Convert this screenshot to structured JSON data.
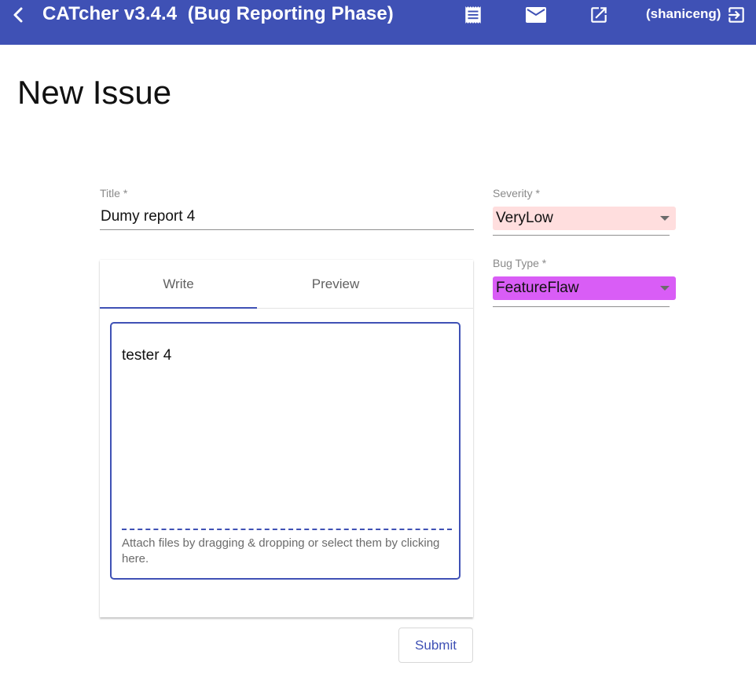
{
  "toolbar": {
    "title": "CATcher v3.4.4  (Bug Reporting Phase)",
    "user": "(shaniceng)",
    "icons": [
      "back-arrow-icon",
      "receipt-icon",
      "mail-icon",
      "open-in-new-icon",
      "logout-icon"
    ]
  },
  "page": {
    "heading": "New Issue"
  },
  "form": {
    "title_label": "Title *",
    "title_value": "Dumy report 4",
    "tabs": [
      "Write",
      "Preview"
    ],
    "active_tab": "Write",
    "description": "tester 4",
    "attach_hint": "Attach files by dragging & dropping or select them by clicking here.",
    "submit_label": "Submit"
  },
  "severity": {
    "label": "Severity *",
    "value": "VeryLow",
    "color": "#ffdede"
  },
  "bug_type": {
    "label": "Bug Type *",
    "value": "FeatureFlaw",
    "color": "#d95df6"
  },
  "colors": {
    "primary": "#3f51b5"
  }
}
